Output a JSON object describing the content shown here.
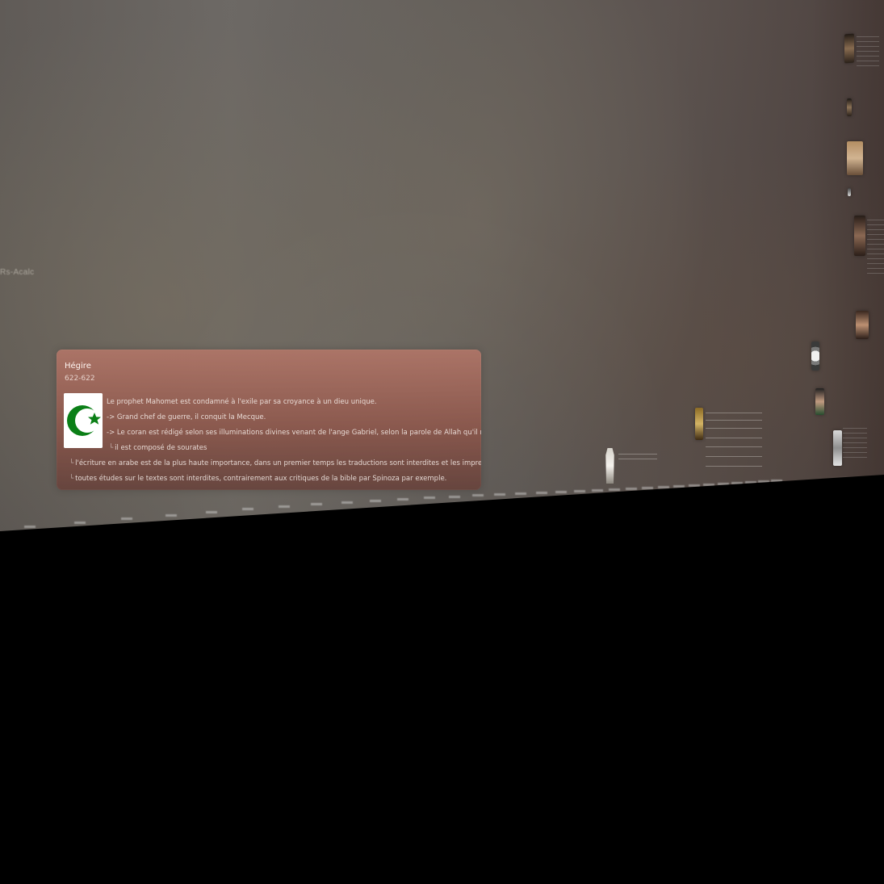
{
  "scene": {
    "left_fragment": "Rs-Acalc"
  },
  "event_card": {
    "title": "Hégire",
    "date_range": "622-622",
    "image_icon": "crescent-star-icon",
    "lines": [
      "Le prophet Mahomet est condamné à l'exile par sa croyance à un dieu unique.",
      "-> Grand chef de guerre, il conquit la Mecque.",
      "-> Le coran est rédigé selon ses illuminations divines venant de l'ange Gabriel, selon la parole de Allah qu'il ne fait que réciter aux hommes.",
      "il est composé de sourates",
      "l'écriture en arabe est de la plus haute importance, dans un premier  temps les traductions sont interdites et les impressions proscrites",
      "toutes études sur le textes sont interdites, contrairement aux critiques  de la bible par Spinoza par exemple."
    ]
  },
  "colors": {
    "card_top": "#B47668",
    "card_bottom": "#67403A",
    "background": "#5E5954",
    "icon_green": "#008000"
  }
}
